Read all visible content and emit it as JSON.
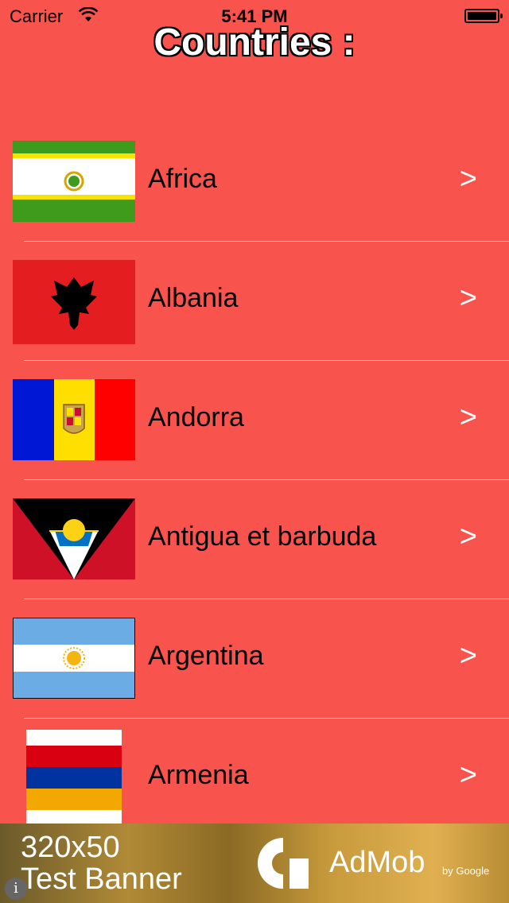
{
  "status": {
    "carrier": "Carrier",
    "time": "5:41 PM"
  },
  "header": {
    "title": "Countries :"
  },
  "rows": [
    {
      "name": "Africa",
      "chevron": ">",
      "flag_icon": "african-union-flag-icon"
    },
    {
      "name": "Albania",
      "chevron": ">",
      "flag_icon": "albania-flag-icon"
    },
    {
      "name": "Andorra",
      "chevron": ">",
      "flag_icon": "andorra-flag-icon"
    },
    {
      "name": "Antigua et barbuda",
      "chevron": ">",
      "flag_icon": "antigua-barbuda-flag-icon"
    },
    {
      "name": "Argentina",
      "chevron": ">",
      "flag_icon": "argentina-flag-icon"
    },
    {
      "name": "Armenia",
      "chevron": ">",
      "flag_icon": "armenia-flag-icon"
    }
  ],
  "ad": {
    "line1": "320x50",
    "line2": "Test Banner",
    "brand": "AdMob",
    "by": "by Google",
    "info": "i"
  },
  "colors": {
    "background": "#f9534e",
    "separator": "#fbd2cf"
  }
}
